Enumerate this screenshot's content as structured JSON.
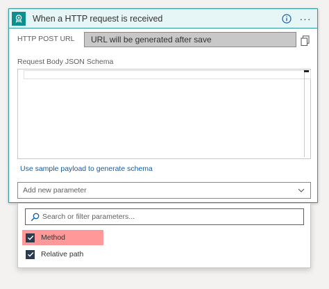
{
  "card": {
    "title": "When a HTTP request is received",
    "more_label": "···",
    "url_label": "HTTP POST URL",
    "url_value": "URL will be generated after save",
    "schema_label": "Request Body JSON Schema",
    "schema_value": "",
    "sample_link": "Use sample payload to generate schema",
    "add_param_placeholder": "Add new parameter"
  },
  "param_panel": {
    "search_placeholder": "Search or filter parameters...",
    "options": [
      {
        "label": "Method",
        "checked": true,
        "highlighted": true
      },
      {
        "label": "Relative path",
        "checked": true,
        "highlighted": false
      }
    ]
  },
  "colors": {
    "accent": "#0e8f8f",
    "header_bg": "#e6f5f5",
    "link": "#0f5ea8",
    "highlight": "#ff9999",
    "checkbox": "#2b3c4e"
  },
  "icons": {
    "trigger": "http-request-icon",
    "info": "info-icon",
    "more": "more-icon",
    "copy": "copy-icon",
    "search": "search-icon",
    "chevron": "chevron-down-icon",
    "check": "checkmark-icon"
  }
}
